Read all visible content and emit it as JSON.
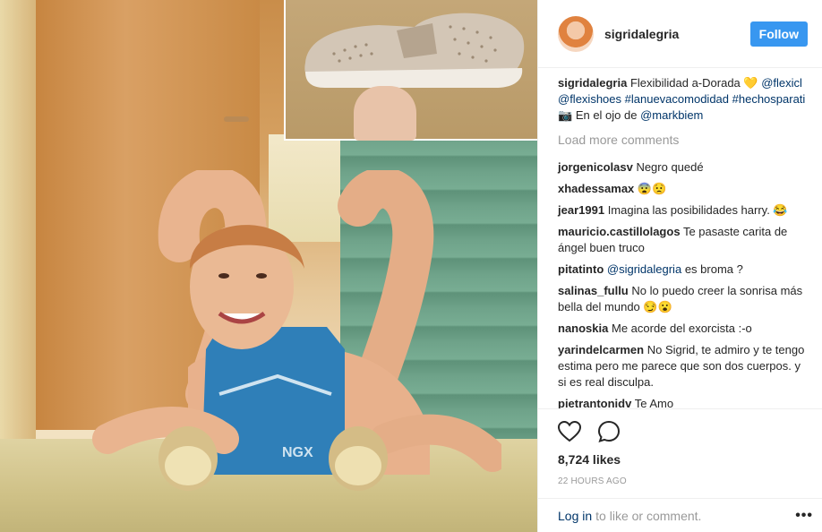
{
  "header": {
    "username": "sigridalegria",
    "follow_label": "Follow"
  },
  "caption": {
    "username": "sigridalegria",
    "text": "Flexibilidad a-Dorada 💛",
    "tag1": "@flexicl",
    "tag2": "@flexishoes",
    "tag3": "#lanuevacomodidad",
    "tag4": "#hechosparati",
    "camera": "📷",
    "text2": "En el ojo de",
    "tag5": "@markbiem"
  },
  "load_more": "Load more comments",
  "comments": [
    {
      "user": "jorgenicolasv",
      "text": "Negro quedé"
    },
    {
      "user": "xhadessamax",
      "text": "😨😟"
    },
    {
      "user": "jear1991",
      "text": "Imagina las posibilidades harry. 😂"
    },
    {
      "user": "mauricio.castillolagos",
      "text": "Te pasaste carita de ángel buen truco"
    },
    {
      "user": "pitatinto",
      "mention": "@sigridalegria",
      "text": "es broma ?"
    },
    {
      "user": "salinas_fullu",
      "text": "No lo puedo creer la sonrisa más bella del mundo 😏😮"
    },
    {
      "user": "nanoskia",
      "text": "Me acorde del exorcista :-o"
    },
    {
      "user": "yarindelcarmen",
      "text": "No Sigrid, te admiro y te tengo estima pero me parece que son dos cuerpos. y si es real disculpa."
    },
    {
      "user": "pietrantonidv",
      "text": "Te Amo"
    }
  ],
  "actions": {
    "like_icon": "heart-icon",
    "comment_icon": "comment-icon",
    "likes": "8,724 likes",
    "timestamp": "22 HOURS AGO"
  },
  "footer": {
    "login_link": "Log in",
    "login_rest": "to like or comment.",
    "more": "•••"
  }
}
